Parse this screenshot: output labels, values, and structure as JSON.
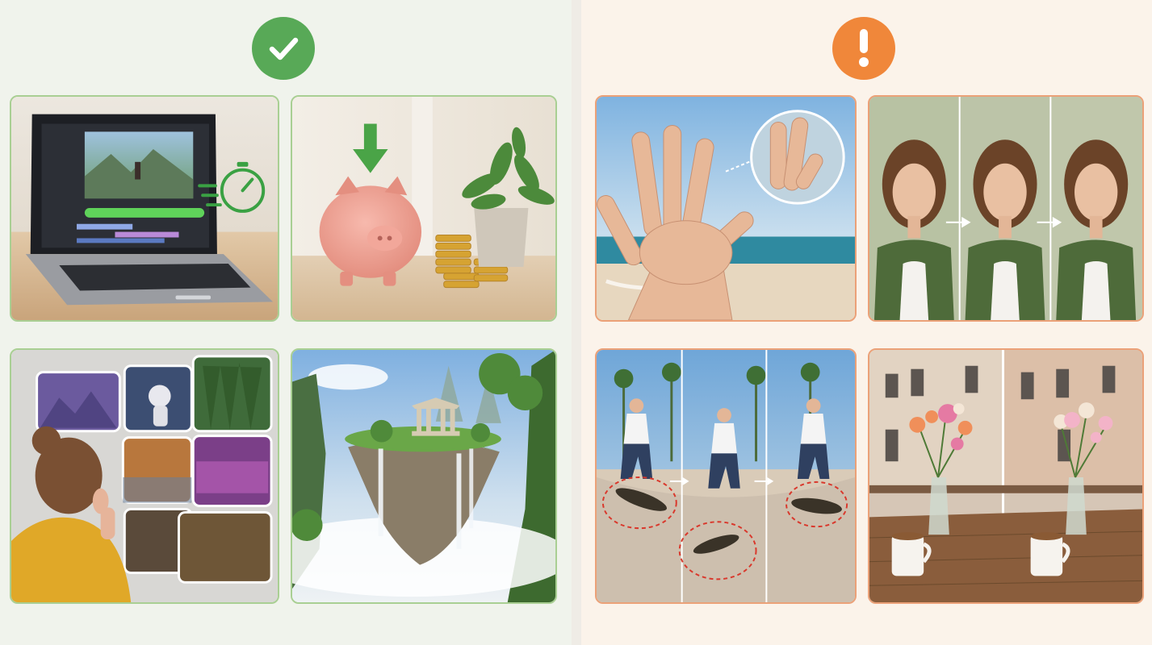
{
  "colors": {
    "good_accent": "#58a957",
    "bad_accent": "#f0873a",
    "good_border": "#a9cf93",
    "bad_border": "#eba178",
    "good_background": "#f0f3ec",
    "bad_background": "#fbf3ea",
    "defect_marker": "#d9382c"
  },
  "left_panel": {
    "badge_icon": "checkmark-icon",
    "cards": [
      {
        "id": "fast-editing",
        "icon": "stopwatch-icon"
      },
      {
        "id": "cost-savings",
        "icon": "down-arrow-icon"
      },
      {
        "id": "concept-art-wall",
        "icon": "none"
      },
      {
        "id": "fantasy-landscape",
        "icon": "none"
      }
    ]
  },
  "right_panel": {
    "badge_icon": "exclamation-icon",
    "cards": [
      {
        "id": "extra-finger-hand",
        "icon": "magnifier-circle-icon"
      },
      {
        "id": "identity-drift-frames",
        "icon": "right-arrow-icon"
      },
      {
        "id": "skateboard-inconsistency",
        "icon": "dashed-circle-icon"
      },
      {
        "id": "scene-inconsistency",
        "icon": "none"
      }
    ]
  }
}
